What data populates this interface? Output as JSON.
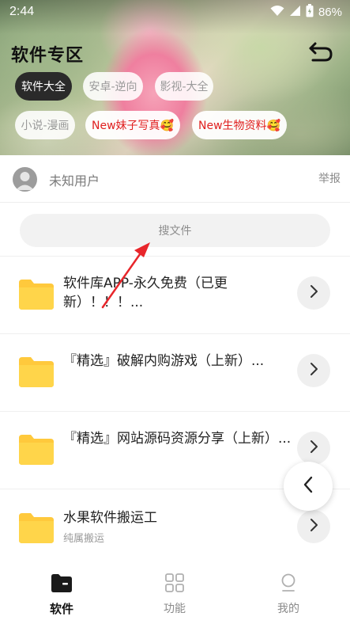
{
  "status_bar": {
    "time": "2:44",
    "battery": "86%"
  },
  "header": {
    "title": "软件专区",
    "chips": [
      "软件大全",
      "安卓-逆向",
      "影视-大全",
      "小说-漫画",
      "New妹子写真🥰",
      "New生物资料🥰"
    ],
    "active_chip": "软件大全"
  },
  "user": {
    "name": "未知用户",
    "report_label": "举报"
  },
  "search": {
    "placeholder": "搜文件"
  },
  "files": [
    {
      "title": "软件库APP-永久免费（已更新）！！！...",
      "subtitle": ""
    },
    {
      "title": "『精选』破解内购游戏（上新）...",
      "subtitle": ""
    },
    {
      "title": "『精选』网站源码资源分享（上新）...",
      "subtitle": ""
    },
    {
      "title": "水果软件搬运工",
      "subtitle": "纯属搬运"
    }
  ],
  "bottom_nav": {
    "items": [
      "软件",
      "功能",
      "我的"
    ],
    "active": "软件"
  },
  "colors": {
    "accent_red": "#e02020",
    "folder_yellow": "#ffd54a",
    "annotation_red": "#e8262b"
  },
  "icons": [
    "wifi-icon",
    "signal-icon",
    "battery-icon",
    "undo-icon",
    "folder-icon",
    "chevron-right-icon",
    "chevron-left-icon",
    "folder-tab-icon",
    "grid-icon",
    "person-icon"
  ]
}
